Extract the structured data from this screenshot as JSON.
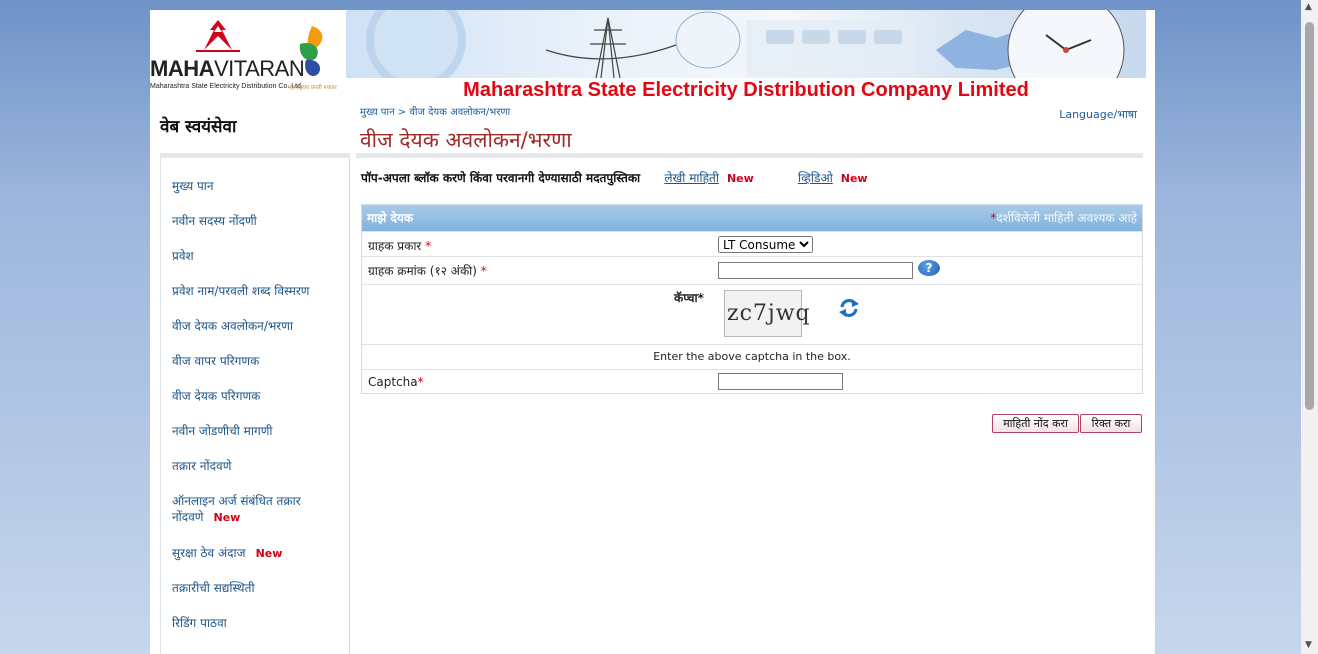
{
  "header": {
    "brand_bold": "MAHA",
    "brand_light": "VITARAN",
    "brand_sub": "Maharashtra State Electricity Distribution Co. Ltd.",
    "brand_tagline": "महाराष्ट्राला प्रगती पथावर",
    "company_title": "Maharashtra State Electricity Distribution Company Limited",
    "site_title": "वेब स्वयंसेवा",
    "breadcrumb": "मुख्य पान > वीज देयक अवलोकन/भरणा",
    "language": "Language/भाषा",
    "page_heading": "वीज देयक अवलोकन/भरणा"
  },
  "sidebar": {
    "items": [
      {
        "label": "मुख्य पान"
      },
      {
        "label": "नवीन सदस्य नोंदणी"
      },
      {
        "label": "प्रवेश"
      },
      {
        "label": "प्रवेश नाम/परवली शब्द विस्मरण"
      },
      {
        "label": "वीज देयक अवलोकन/भरणा"
      },
      {
        "label": "वीज वापर परिगणक"
      },
      {
        "label": "वीज देयक परिगणक"
      },
      {
        "label": "नवीन जोडणीची मागणी"
      },
      {
        "label": "तक्रार नोंदवणे"
      },
      {
        "label": "ऑनलाइन अर्ज संबंधित तक्रार नोंदवणे",
        "badge": "New"
      },
      {
        "label": "सुरक्षा ठेव अंदाज",
        "badge": "New"
      },
      {
        "label": "तक्रारीची सद्यस्थिती"
      },
      {
        "label": "रिडिंग पाठवा"
      }
    ]
  },
  "help": {
    "text": "पॉप-अपला ब्लॉक करणे किंवा परवानगी देण्यासाठी मदतपुस्तिका",
    "link1": "लेखी माहिती",
    "link1_badge": "New",
    "link2": "व्हिडिओ",
    "link2_badge": "New"
  },
  "form": {
    "title": "माझे देयक",
    "required_note": "दर्शविलेली माहिती अवश्यक आहे",
    "consumer_type_label": "ग्राहक प्रकार",
    "consumer_type_value": "LT Consumer",
    "consumer_no_label": "ग्राहक क्रमांक (१२ अंकी)",
    "captcha_label": "कॅप्चा*",
    "captcha_text": "zc7jwq",
    "captcha_hint": "Enter the above captcha in the box.",
    "captcha_input_label": "Captcha",
    "submit_label": "माहिती नोंद करा",
    "reset_label": "रिक्त करा"
  }
}
